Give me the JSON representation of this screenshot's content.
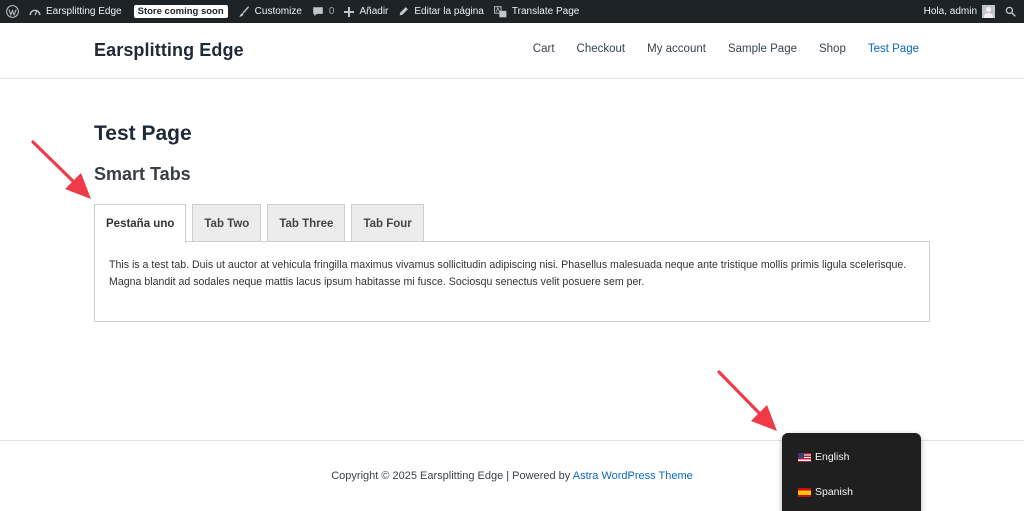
{
  "admin_bar": {
    "site_name": "Earsplitting Edge",
    "store_badge": "Store coming soon",
    "customize": "Customize",
    "comments_count": "0",
    "add_new": "Añadir",
    "edit_page": "Editar la página",
    "translate_page": "Translate Page",
    "greeting": "Hola, admin"
  },
  "header": {
    "site_title": "Earsplitting Edge",
    "nav": [
      {
        "label": "Cart"
      },
      {
        "label": "Checkout"
      },
      {
        "label": "My account"
      },
      {
        "label": "Sample Page"
      },
      {
        "label": "Shop"
      },
      {
        "label": "Test Page",
        "current": true
      }
    ]
  },
  "content": {
    "page_title": "Test Page",
    "block_heading": "Smart Tabs",
    "tabs": [
      {
        "label": "Pestaña uno",
        "active": true
      },
      {
        "label": "Tab Two"
      },
      {
        "label": "Tab Three"
      },
      {
        "label": "Tab Four"
      }
    ],
    "tab_content": "This is a test tab. Duis ut auctor at vehicula fringilla maximus vivamus sollicitudin adipiscing nisi. Phasellus malesuada neque ante tristique mollis primis ligula scelerisque. Magna blandit ad sodales neque mattis lacus ipsum habitasse mi fusce. Sociosqu senectus velit posuere sem per."
  },
  "footer": {
    "copyright_prefix": "Copyright © 2025 Earsplitting Edge | Powered by",
    "theme_link": "Astra WordPress Theme"
  },
  "language_switcher": {
    "languages": [
      {
        "label": "English",
        "flag": "us-flag-icon"
      },
      {
        "label": "Spanish",
        "flag": "es-flag-icon"
      }
    ]
  },
  "colors": {
    "admin_bar_bg": "#1d2327",
    "link_accent": "#0969c3",
    "annotation_arrow": "#ee3b47",
    "switcher_bg": "#1f1f1f"
  }
}
